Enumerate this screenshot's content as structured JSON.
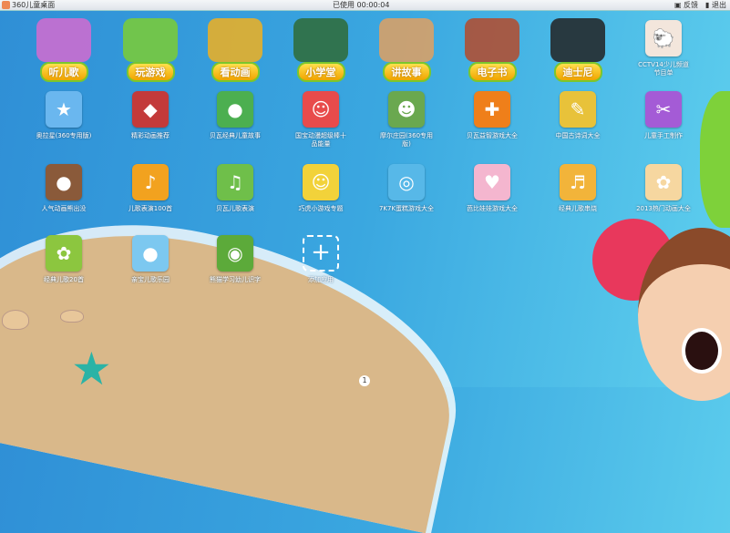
{
  "topbar": {
    "title": "360儿童桌面",
    "timer": "已使用 00:00:04",
    "feedback": "反馈",
    "exit": "退出"
  },
  "categories": [
    {
      "label": "听儿歌",
      "icon": "girl-singing-icon",
      "color": "#d36bd0"
    },
    {
      "label": "玩游戏",
      "icon": "green-monster-icon",
      "color": "#7ccc33"
    },
    {
      "label": "看动画",
      "icon": "headphones-icon",
      "color": "#f0b020"
    },
    {
      "label": "小学堂",
      "icon": "chalkboard-icon",
      "color": "#2f6b36"
    },
    {
      "label": "讲故事",
      "icon": "book-reading-icon",
      "color": "#e0a060"
    },
    {
      "label": "电子书",
      "icon": "ebook-icon",
      "color": "#b54a2a"
    },
    {
      "label": "迪士尼",
      "icon": "mickey-icon",
      "color": "#222222"
    }
  ],
  "apps": [
    {
      "label": "CCTV14少儿频道节目单",
      "color": "#f3e6dc",
      "glyph": "🐑"
    },
    {
      "label": "奥拉星(360专用版)",
      "color": "#6ab7ef",
      "glyph": "★"
    },
    {
      "label": "精彩动画推荐",
      "color": "#c33a3a",
      "glyph": "◆"
    },
    {
      "label": "贝瓦经典儿童故事",
      "color": "#4caf50",
      "glyph": "●"
    },
    {
      "label": "国宝动漫超级棒十品能量",
      "color": "#e84b4b",
      "glyph": "☺"
    },
    {
      "label": "摩尔庄园(360专用版)",
      "color": "#6aa84f",
      "glyph": "☻"
    },
    {
      "label": "贝瓦益智游戏大全",
      "color": "#ef7f1a",
      "glyph": "✚"
    },
    {
      "label": "中国古诗词大全",
      "color": "#e8c23a",
      "glyph": "✎"
    },
    {
      "label": "儿童手工制作",
      "color": "#a45bd6",
      "glyph": "✂"
    },
    {
      "label": "人气动画熊出没",
      "color": "#8a5a3a",
      "glyph": "●"
    },
    {
      "label": "儿歌表演100首",
      "color": "#f2a21f",
      "glyph": "♪"
    },
    {
      "label": "贝瓦儿歌表演",
      "color": "#6fbf4a",
      "glyph": "♫"
    },
    {
      "label": "巧虎小游戏专题",
      "color": "#f2d23a",
      "glyph": "☺"
    },
    {
      "label": "7K7K蛋糕游戏大全",
      "color": "#57b8e8",
      "glyph": "◎"
    },
    {
      "label": "芭比娃娃游戏大全",
      "color": "#f4b6cf",
      "glyph": "♥"
    },
    {
      "label": "经典儿歌串烧",
      "color": "#f2b43a",
      "glyph": "♬"
    },
    {
      "label": "2013热门动画大全",
      "color": "#f6d7a0",
      "glyph": "✿"
    },
    {
      "label": "经典儿歌20首",
      "color": "#8cc63f",
      "glyph": "✿"
    },
    {
      "label": "亲宝儿歌乐园",
      "color": "#7cc8f0",
      "glyph": "●"
    },
    {
      "label": "熊猫学习幼儿识字",
      "color": "#5caa3a",
      "glyph": "◉"
    },
    {
      "label": "添加应用",
      "color": "transparent",
      "glyph": "+"
    }
  ],
  "pager": {
    "current": "1"
  }
}
